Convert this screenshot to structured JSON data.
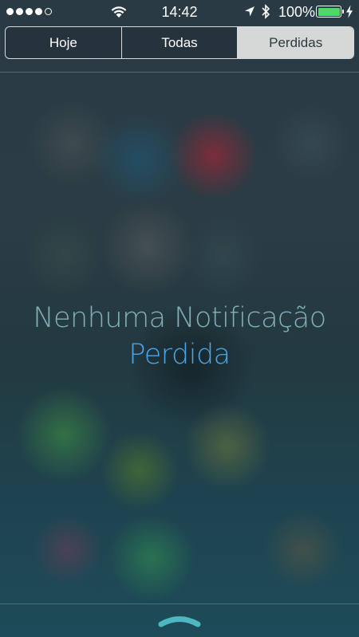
{
  "status_bar": {
    "time": "14:42",
    "battery_percent": "100%",
    "battery_level": 1.0,
    "signal_bars_filled": 4,
    "signal_bars_total": 5,
    "battery_color": "#4cd964"
  },
  "segmented_control": {
    "segments": [
      "Hoje",
      "Todas",
      "Perdidas"
    ],
    "selected": "Perdidas"
  },
  "empty_state": {
    "line1": "Nenhuma Notificação",
    "line2": "Perdida"
  },
  "colors": {
    "accent": "#4aa6e8"
  }
}
